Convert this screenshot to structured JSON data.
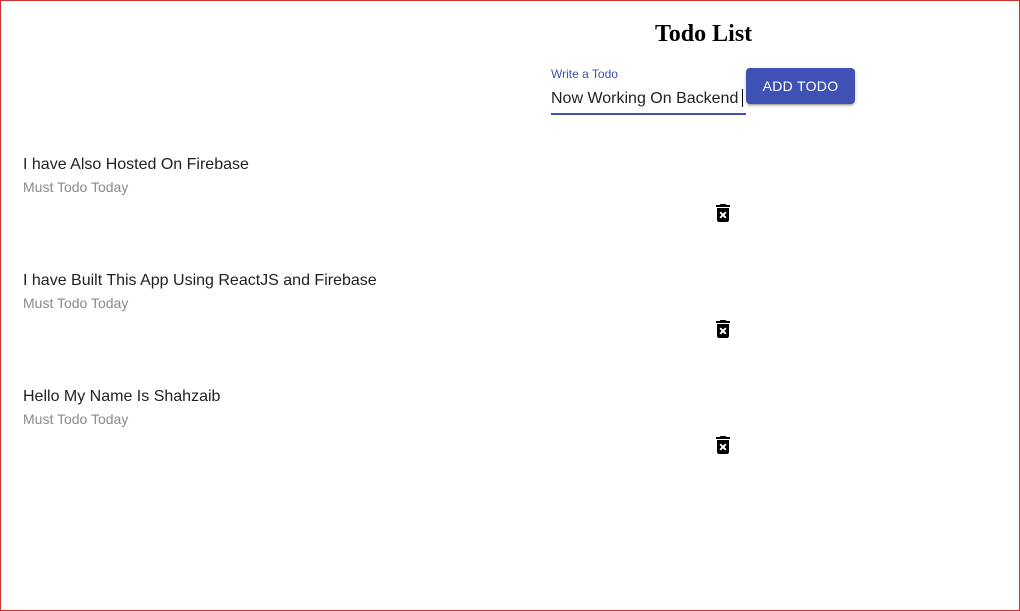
{
  "header": {
    "title": "Todo List"
  },
  "form": {
    "label": "Write a Todo",
    "value": "Now Working On Backend",
    "add_label": "ADD TODO"
  },
  "todos": [
    {
      "text": "I have Also Hosted On Firebase",
      "subtitle": "Must Todo Today",
      "delete_icon": "delete-forever-icon"
    },
    {
      "text": "I have Built This App Using ReactJS and Firebase",
      "subtitle": "Must Todo Today",
      "delete_icon": "delete-forever-icon"
    },
    {
      "text": "Hello My Name Is Shahzaib",
      "subtitle": "Must Todo Today",
      "delete_icon": "delete-forever-icon"
    }
  ],
  "colors": {
    "accent": "#3f51b5",
    "border": "#d32f2f",
    "secondary_text": "#8a8a8a"
  }
}
